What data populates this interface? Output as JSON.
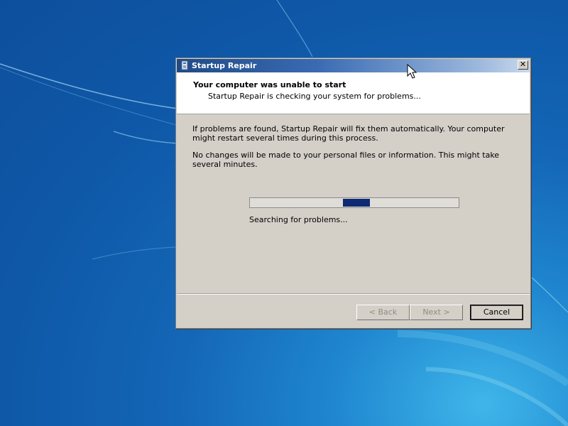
{
  "window": {
    "title": "Startup Repair",
    "close_symbol": "✕"
  },
  "header": {
    "title": "Your computer was unable to start",
    "subtitle": "Startup Repair is checking your system for problems..."
  },
  "body": {
    "paragraph1": "If problems are found, Startup Repair will fix them automatically. Your computer might restart several times during this process.",
    "paragraph2": "No changes will be made to your personal files or information. This might take several minutes."
  },
  "progress": {
    "status_text": "Searching for problems...",
    "style": "marquee",
    "chunk_start_fraction": 0.445,
    "chunk_end_fraction": 0.575,
    "chunk_color": "#0e2a72"
  },
  "buttons": {
    "back_label": "< Back",
    "next_label": "Next >",
    "cancel_label": "Cancel"
  },
  "icons": {
    "title_icon": "startup-repair-icon",
    "close_icon": "close-icon",
    "cursor": "mouse-pointer-icon"
  },
  "colors": {
    "titlebar_start": "#1f4a86",
    "titlebar_end": "#c8d8ec",
    "dialog_face": "#d4d0c8",
    "desktop_blue": "#1466b6"
  }
}
